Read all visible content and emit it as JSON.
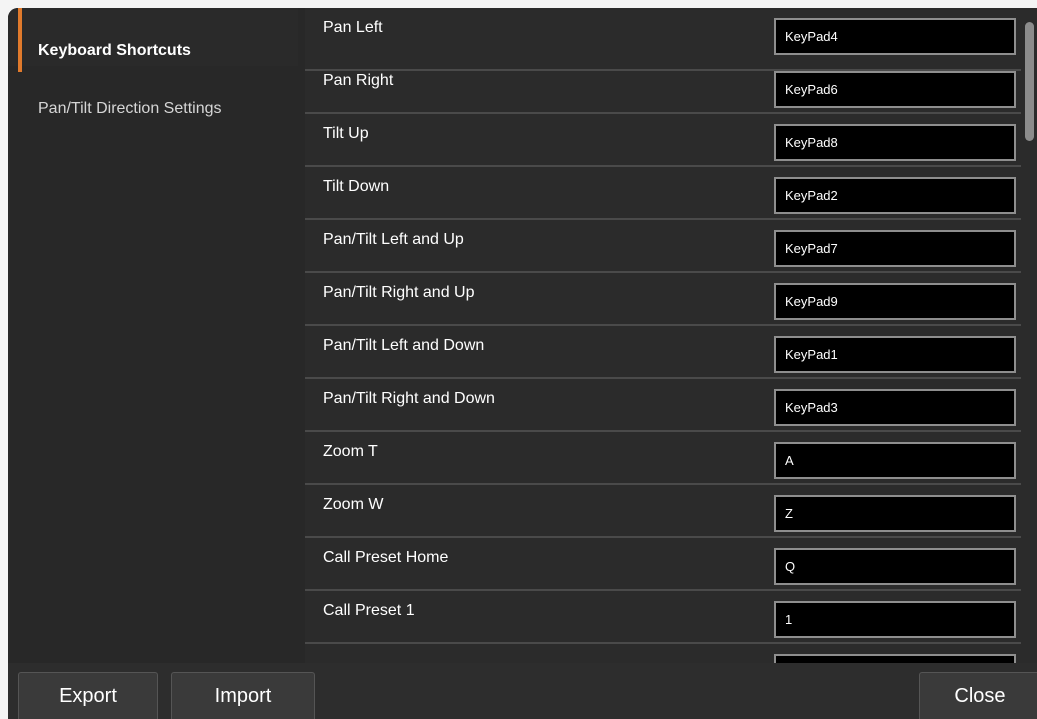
{
  "sidebar": {
    "items": [
      {
        "label": "Keyboard Shortcuts",
        "active": true
      },
      {
        "label": "Pan/Tilt Direction Settings",
        "active": false
      }
    ]
  },
  "shortcuts": [
    {
      "label": "Pan Left",
      "value": "KeyPad4"
    },
    {
      "label": "Pan Right",
      "value": "KeyPad6"
    },
    {
      "label": "Tilt Up",
      "value": "KeyPad8"
    },
    {
      "label": "Tilt Down",
      "value": "KeyPad2"
    },
    {
      "label": "Pan/Tilt Left and Up",
      "value": "KeyPad7"
    },
    {
      "label": "Pan/Tilt Right and Up",
      "value": "KeyPad9"
    },
    {
      "label": "Pan/Tilt Left and Down",
      "value": "KeyPad1"
    },
    {
      "label": "Pan/Tilt Right and Down",
      "value": "KeyPad3"
    },
    {
      "label": "Zoom T",
      "value": "A"
    },
    {
      "label": "Zoom W",
      "value": "Z"
    },
    {
      "label": "Call Preset Home",
      "value": "Q"
    },
    {
      "label": "Call Preset 1",
      "value": "1"
    },
    {
      "label": "",
      "value": ""
    }
  ],
  "footer": {
    "export_label": "Export",
    "import_label": "Import",
    "close_label": "Close"
  },
  "colors": {
    "accent": "#e07a2c",
    "background": "#2d2d2d",
    "input_background": "#000000"
  }
}
